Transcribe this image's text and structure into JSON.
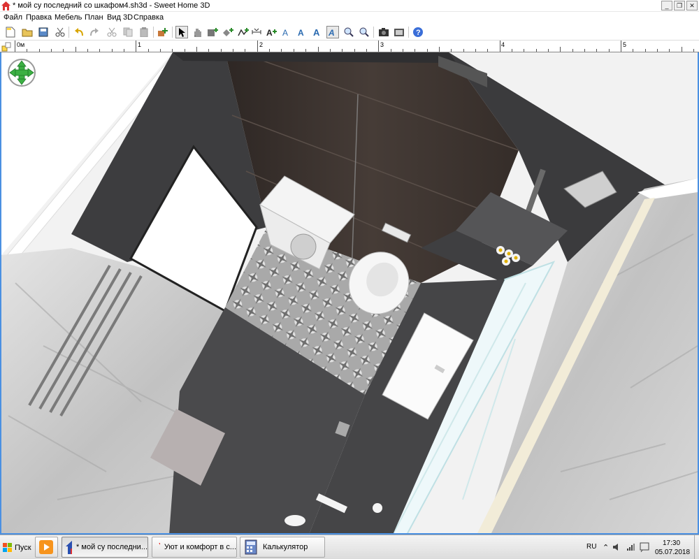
{
  "window": {
    "title": "* мой су последний со шкафом4.sh3d - Sweet Home 3D",
    "minimize": "_",
    "restore": "❐",
    "close": "✕"
  },
  "menu": [
    "Файл",
    "Правка",
    "Мебель",
    "План",
    "Вид 3D",
    "Справка"
  ],
  "toolbar": [
    "new-icon",
    "open-icon",
    "save-icon",
    "cut-icon",
    "undo-icon",
    "redo-icon",
    "cut2-icon",
    "copy-icon",
    "paste-icon",
    "add-furniture-icon",
    "select-icon",
    "pan-icon",
    "create-walls-icon",
    "create-rooms-icon",
    "create-polylines-icon",
    "create-dimensions-icon",
    "create-labels-icon",
    "text-style-icon",
    "text-bold-icon",
    "text-italic-icon",
    "text-size-icon",
    "zoom-in-icon",
    "zoom-out-icon",
    "create-photo-icon",
    "create-video-icon",
    "help-icon"
  ],
  "ruler": {
    "labels": [
      "0м",
      "1",
      "2",
      "3",
      "4",
      "5"
    ]
  },
  "taskbar": {
    "start": "Пуск",
    "tasks": [
      "",
      "* мой су последни...",
      "Уют и комфорт в с...",
      "Калькулятор"
    ],
    "lang": "RU",
    "tray_arrow": "⌃",
    "time": "17:30",
    "date": "05.07.2018"
  },
  "colors": {
    "selection_border": "#4a90e2",
    "wall_dark": "#3e3e40",
    "wood": "#3a322e",
    "marble": "#d6d6d6",
    "tile_dark": "#4c4c4e"
  }
}
